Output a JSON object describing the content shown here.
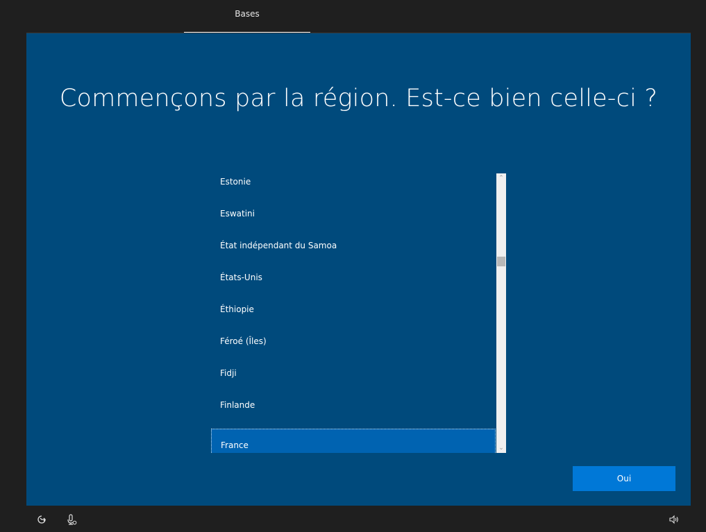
{
  "header": {
    "tab_label": "Bases"
  },
  "main": {
    "title": "Commençons par la région. Est-ce bien celle-ci ?",
    "region_list": [
      "Estonie",
      "Eswatini",
      "État indépendant du Samoa",
      "États-Unis",
      "Éthiopie",
      "Féroé (Îles)",
      "Fidji",
      "Finlande",
      "France"
    ],
    "selected_region": "France",
    "confirm_button": "Oui"
  },
  "bottom_bar": {
    "icons": [
      "accessibility-icon",
      "microphone-icon",
      "volume-icon"
    ]
  },
  "colors": {
    "background": "#1f1f1f",
    "panel": "#004a7c",
    "selection": "#0063b1",
    "button": "#0078d7"
  }
}
